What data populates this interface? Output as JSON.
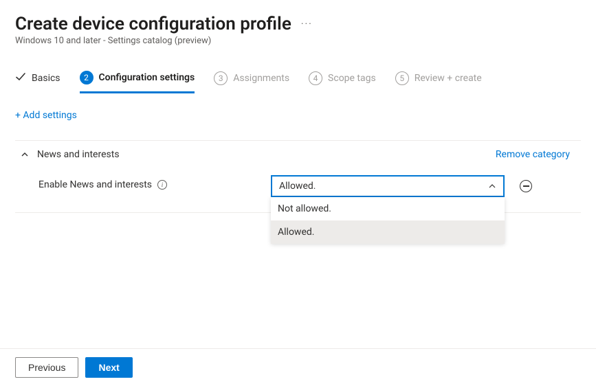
{
  "header": {
    "title": "Create device configuration profile",
    "subtitle": "Windows 10 and later - Settings catalog (preview)"
  },
  "wizard": {
    "steps": [
      {
        "num": "1",
        "label": "Basics"
      },
      {
        "num": "2",
        "label": "Configuration settings"
      },
      {
        "num": "3",
        "label": "Assignments"
      },
      {
        "num": "4",
        "label": "Scope tags"
      },
      {
        "num": "5",
        "label": "Review + create"
      }
    ]
  },
  "addSettings": "+ Add settings",
  "category": {
    "title": "News and interests",
    "removeLabel": "Remove category"
  },
  "setting": {
    "label": "Enable News and interests",
    "selected": "Allowed.",
    "options": [
      "Not allowed.",
      "Allowed."
    ]
  },
  "footer": {
    "prev": "Previous",
    "next": "Next"
  }
}
